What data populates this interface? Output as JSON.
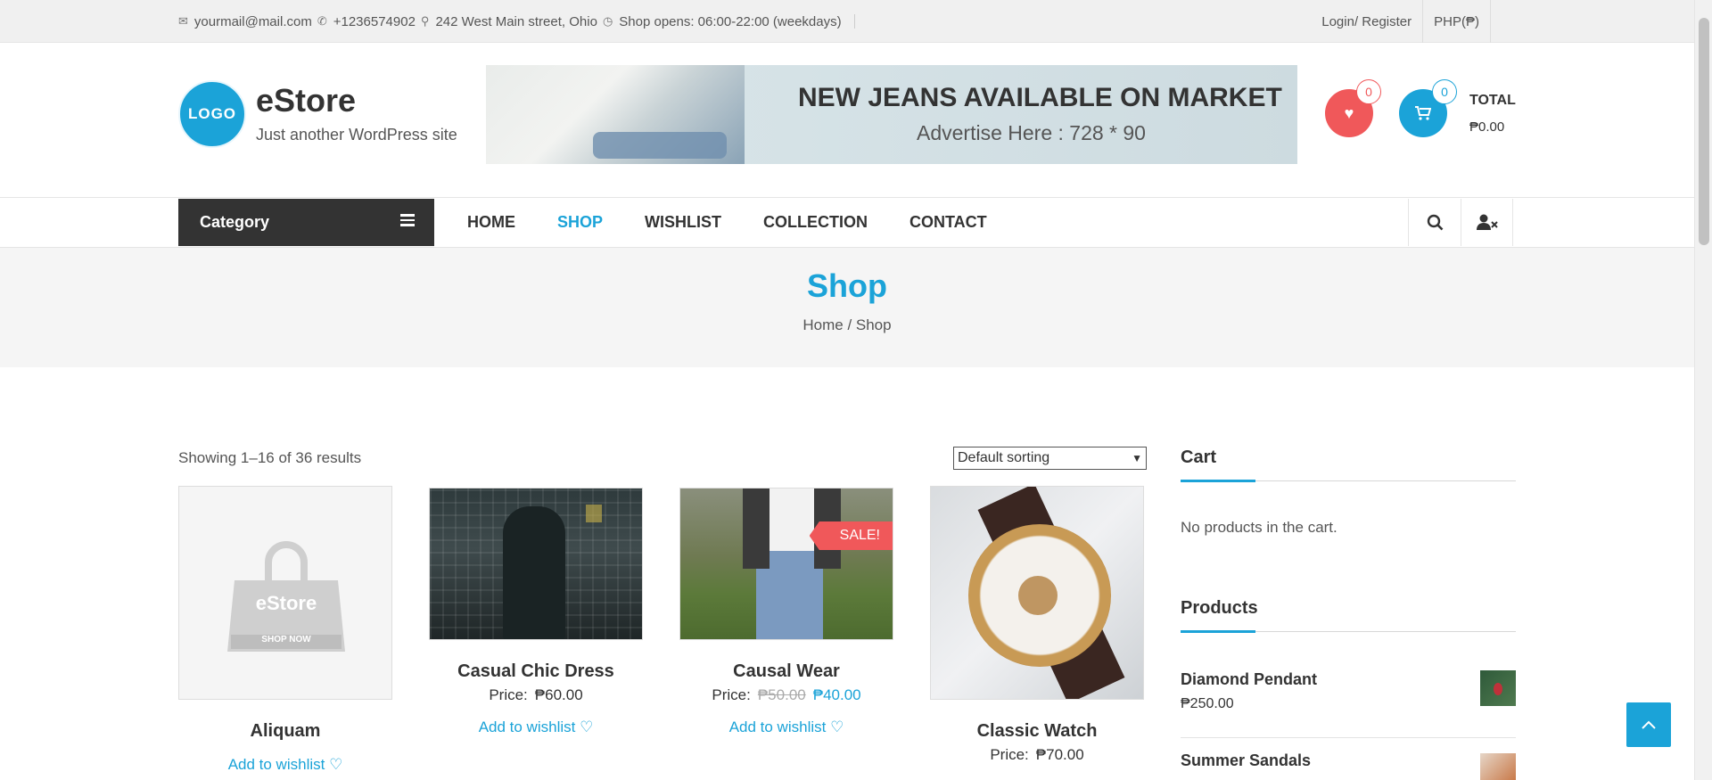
{
  "topbar": {
    "email": "yourmail@mail.com",
    "phone": "+1236574902",
    "address": "242 West Main street, Ohio",
    "hours": "Shop opens: 06:00-22:00 (weekdays)",
    "login": "Login/ Register",
    "currency": "PHP(₱)"
  },
  "header": {
    "logo": "LOGO",
    "site_name": "eStore",
    "tagline": "Just another WordPress site",
    "banner_title": "NEW JEANS AVAILABLE ON MARKET",
    "banner_sub": "Advertise Here : 728 * 90",
    "wishlist_count": "0",
    "cart_count": "0",
    "total_label": "TOTAL",
    "total_value": "₱0.00"
  },
  "nav": {
    "category": "Category",
    "items": [
      "HOME",
      "SHOP",
      "WISHLIST",
      "COLLECTION",
      "CONTACT"
    ],
    "active": "SHOP"
  },
  "page": {
    "title": "Shop",
    "breadcrumb": "Home / Shop"
  },
  "shop": {
    "result_count": "Showing 1–16 of 36 results",
    "sort_selected": "Default sorting",
    "products": [
      {
        "name": "Aliquam",
        "wishlist": "Add to wishlist ♡",
        "placeholder_brand": "eStore",
        "placeholder_cta": "SHOP NOW"
      },
      {
        "name": "Casual Chic Dress",
        "price_label": "Price:",
        "price": "₱60.00",
        "wishlist": "Add to wishlist ♡"
      },
      {
        "name": "Causal Wear",
        "price_label": "Price:",
        "old_price": "₱50.00",
        "price": "₱40.00",
        "badge": "SALE!",
        "wishlist": "Add to wishlist ♡"
      },
      {
        "name": "Classic Watch",
        "price_label": "Price:",
        "price": "₱70.00"
      }
    ]
  },
  "sidebar": {
    "cart_heading": "Cart",
    "cart_empty": "No products in the cart.",
    "products_heading": "Products",
    "products": [
      {
        "name": "Diamond Pendant",
        "price": "₱250.00"
      },
      {
        "name": "Summer Sandals"
      }
    ]
  },
  "colors": {
    "accent": "#1ba3d8",
    "sale": "#f0585a",
    "dark": "#333333"
  }
}
